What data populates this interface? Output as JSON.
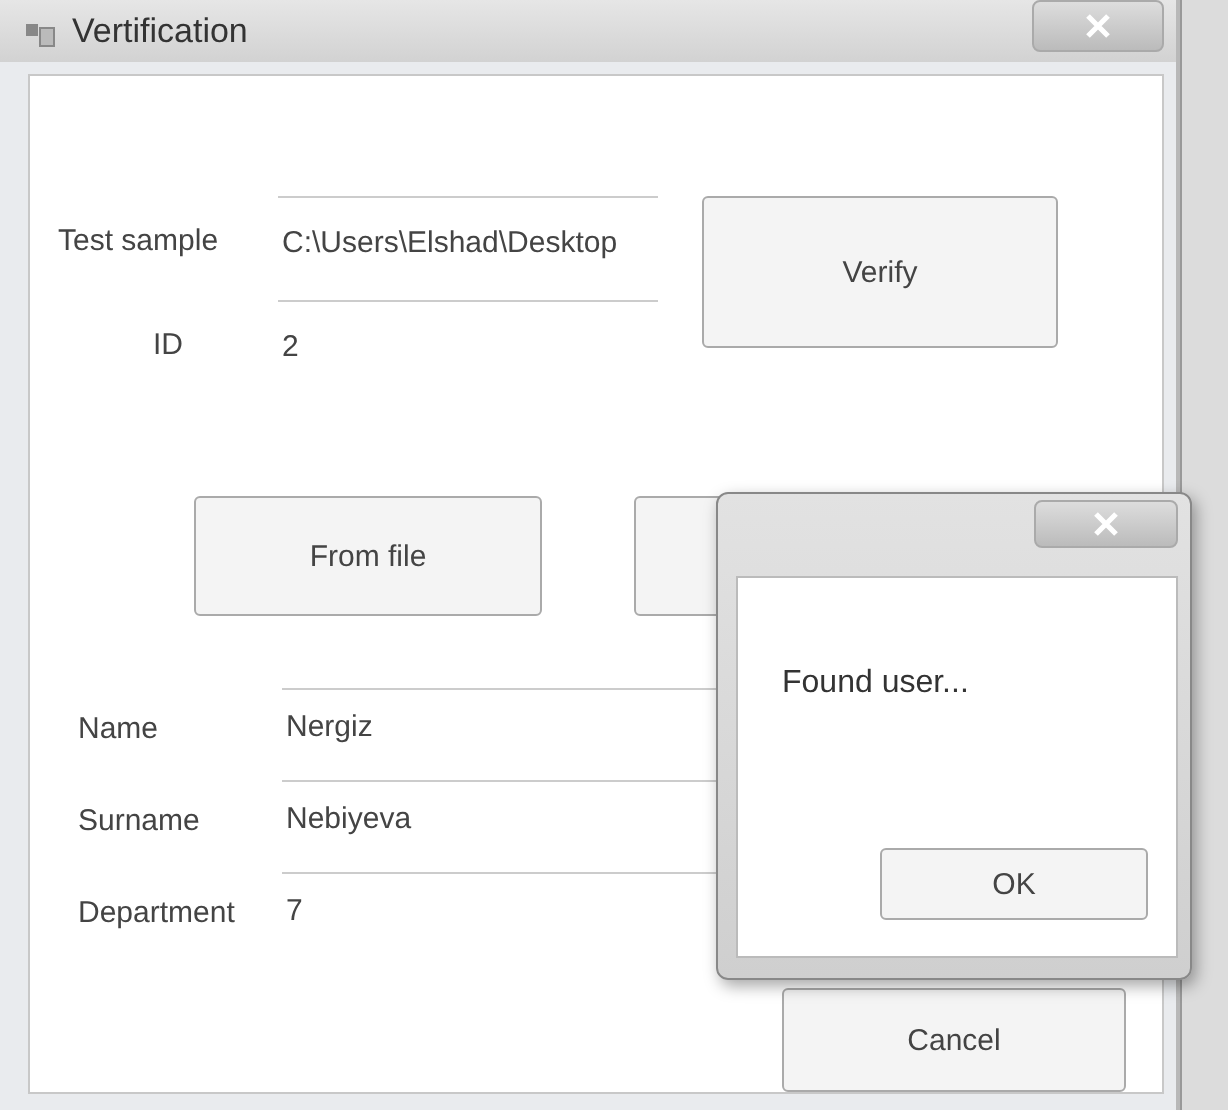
{
  "window": {
    "title": "Vertification"
  },
  "sample": {
    "fields": [
      {
        "label": "Test sample",
        "value": "C:\\Users\\Elshad\\Desktop"
      },
      {
        "label": "ID",
        "value": "2"
      }
    ],
    "verify_button": "Verify"
  },
  "load_buttons": [
    "From file"
  ],
  "person": {
    "fields": [
      {
        "label": "Name",
        "value": "Nergiz"
      },
      {
        "label": "Surname",
        "value": "Nebiyeva"
      },
      {
        "label": "Department",
        "value": "7"
      }
    ]
  },
  "cancel_button": "Cancel",
  "message_box": {
    "message": "Found user...",
    "ok_button": "OK"
  }
}
